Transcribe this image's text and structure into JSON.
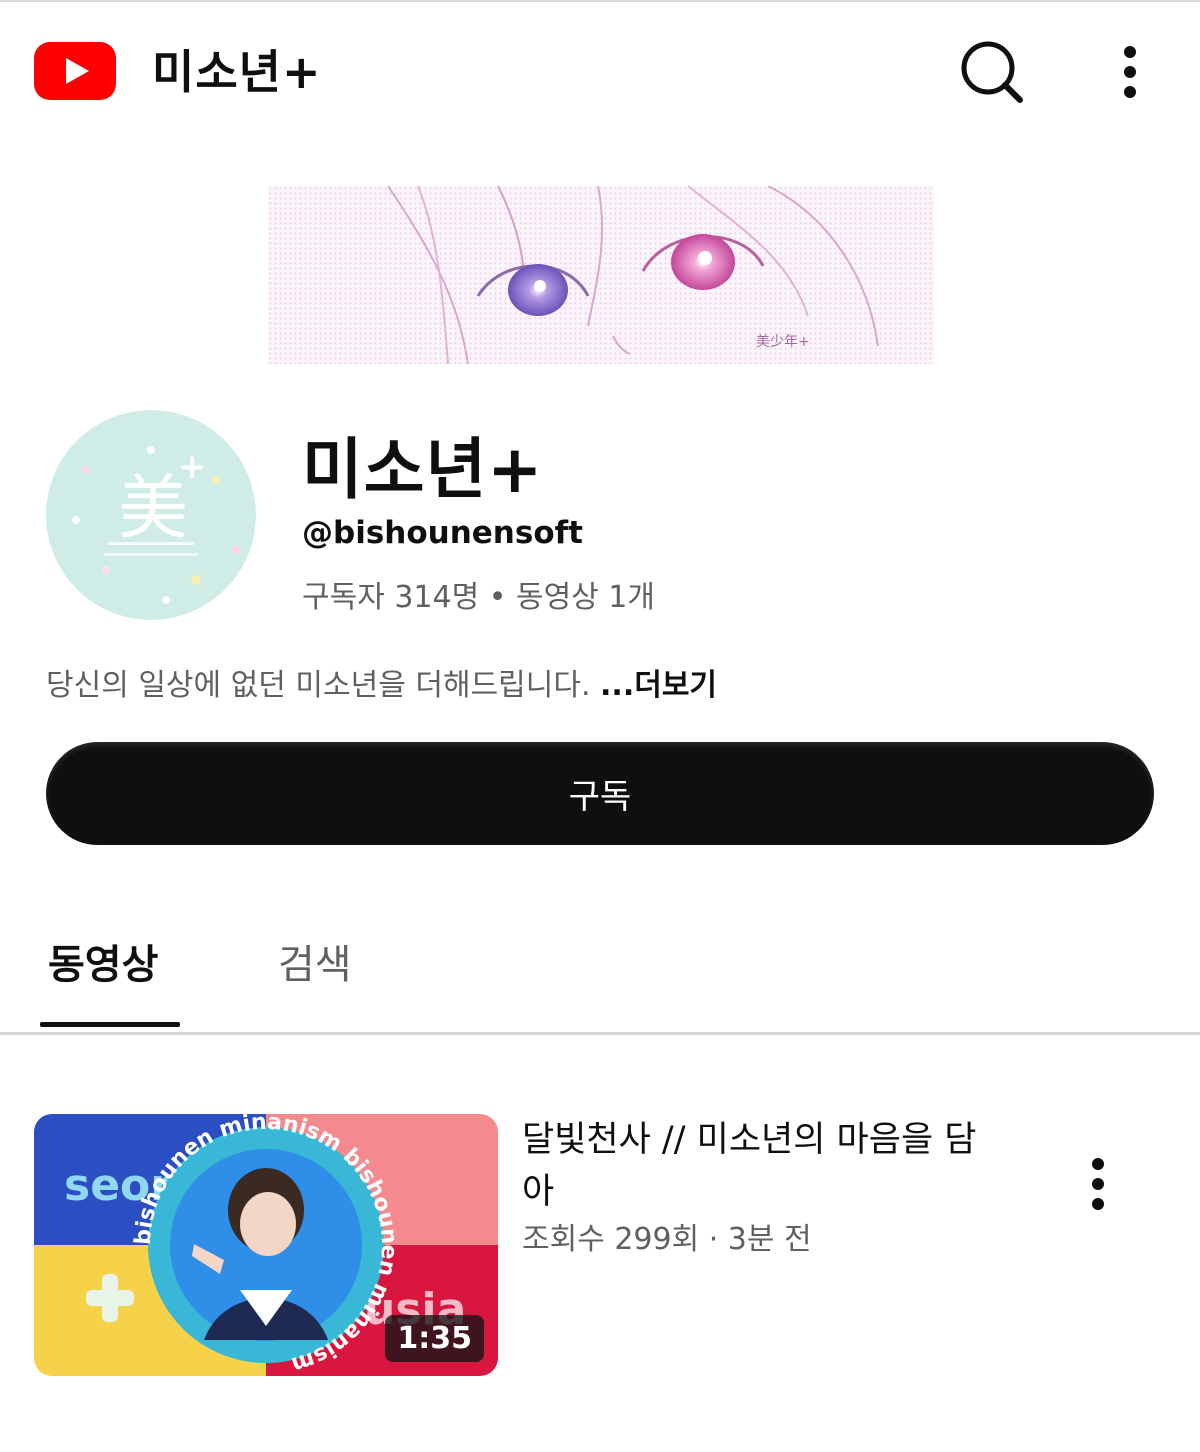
{
  "app": {
    "title": "미소년+",
    "brand_color": "#ff0000",
    "icons": [
      "youtube-logo-icon",
      "search-icon",
      "more-vert-icon"
    ]
  },
  "banner": {
    "watermark_text": "美少年+"
  },
  "avatar": {
    "glyph": "美",
    "plus": "+"
  },
  "channel": {
    "name": "미소년+",
    "handle": "@bishounensoft",
    "stats": "구독자 314명 • 동영상 1개",
    "description": "당신의 일상에 없던 미소년을 더해드립니다. ",
    "more_label": "...더보기"
  },
  "subscribe": {
    "label": "구독"
  },
  "tabs": [
    {
      "label": "동영상",
      "active": true
    },
    {
      "label": "검색",
      "active": false
    }
  ],
  "video": {
    "title": "달빛천사 // 미소년의 마음을 담아",
    "meta": "조회수 299회 · 3분 전",
    "duration": "1:35",
    "thumb_texts": {
      "left_word": "seor",
      "right_word": "usia",
      "ring_text": "bishounen minanism bishounen minanism "
    },
    "thumb_colors": [
      "#2b4fc2",
      "#f58a8e",
      "#f6d24a",
      "#d9163f"
    ]
  }
}
